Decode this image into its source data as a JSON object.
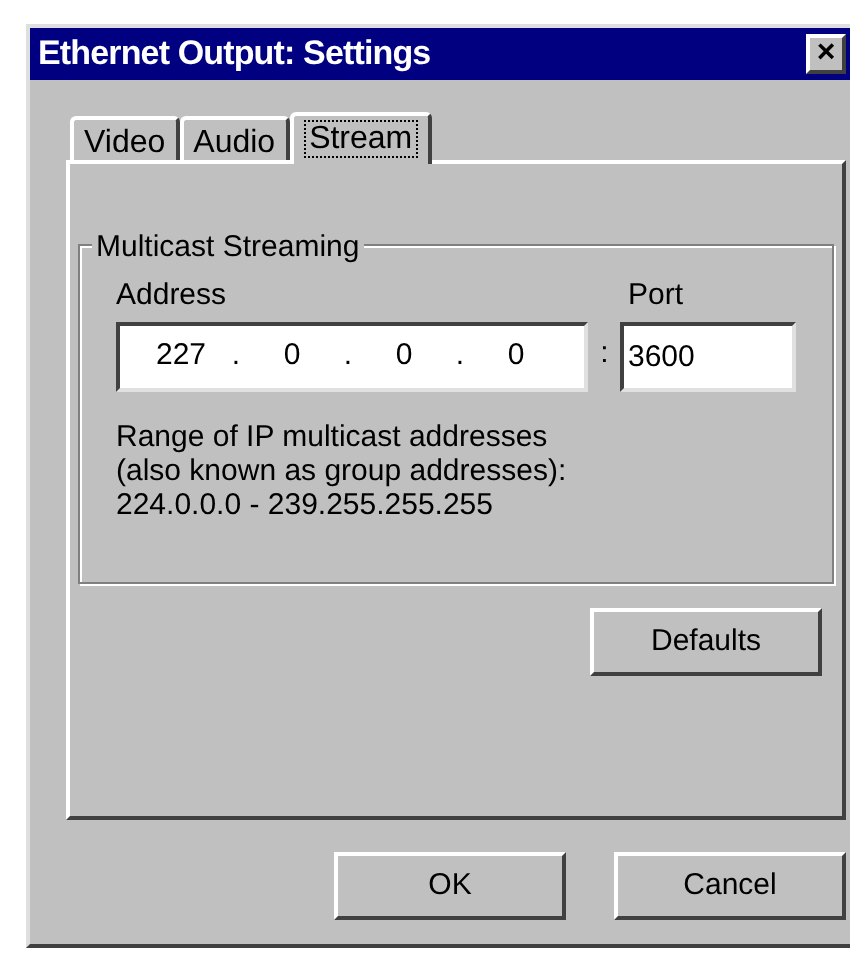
{
  "window": {
    "title": "Ethernet Output: Settings",
    "close": "×"
  },
  "tabs": [
    {
      "label": "Video",
      "selected": false
    },
    {
      "label": "Audio",
      "selected": false
    },
    {
      "label": "Stream",
      "selected": true
    }
  ],
  "group": {
    "title": "Multicast Streaming",
    "address_label": "Address",
    "port_label": "Port",
    "octets": [
      "227",
      "0",
      "0",
      "0"
    ],
    "dot": ".",
    "separator": ":",
    "port": "3600",
    "info": [
      "Range of IP multicast addresses",
      "(also known as group addresses):",
      "224.0.0.0 - 239.255.255.255"
    ]
  },
  "defaults_button": "Defaults",
  "buttons": [
    "OK",
    "Cancel"
  ]
}
